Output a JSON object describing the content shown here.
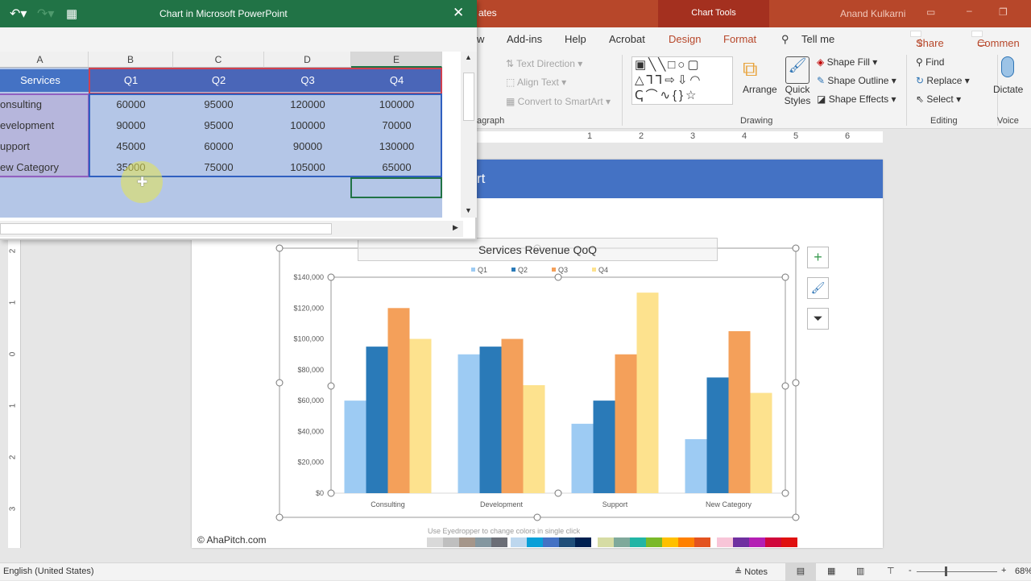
{
  "powerpoint": {
    "title_fragment": "ates",
    "context_tab": "Chart Tools",
    "user": "Anand Kulkarni",
    "tabs": [
      "w",
      "Add-ins",
      "Help",
      "Acrobat",
      "Design",
      "Format"
    ],
    "tell_me": "Tell me",
    "share": "Share",
    "comments": "Commen",
    "ribbon": {
      "paragraph": {
        "text_direction": "Text Direction",
        "align_text": "Align Text",
        "convert_smartart": "Convert to SmartArt",
        "label": "agraph"
      },
      "drawing": {
        "arrange": "Arrange",
        "quick_styles": "Quick Styles",
        "shape_fill": "Shape Fill",
        "shape_outline": "Shape Outline",
        "shape_effects": "Shape Effects",
        "label": "Drawing"
      },
      "editing": {
        "find": "Find",
        "replace": "Replace",
        "select": "Select",
        "label": "Editing"
      },
      "voice": {
        "dictate": "Dictate",
        "label": "Voice"
      }
    },
    "ruler_numbers": [
      "1",
      "2",
      "3",
      "4",
      "5",
      "6"
    ],
    "vruler_numbers": [
      "2",
      "1",
      "0",
      "1",
      "2",
      "3"
    ],
    "status": {
      "language": "English (United States)",
      "notes": "Notes",
      "zoom": "68%"
    }
  },
  "slide": {
    "title_fragment": "rt",
    "footer": "© AhaPitch.com",
    "eyedropper_hint": "Use Eyedropper to change colors in single click",
    "palette": [
      "#d9d9d9",
      "#bfbfbf",
      "#a5968a",
      "#8497a0",
      "#6b6e76",
      "#bdd7ee",
      "#0aa0d8",
      "#4472c4",
      "#1f4e79",
      "#002050",
      "#d6dca4",
      "#7fa99b",
      "#22b5a5",
      "#7ab929",
      "#ffc000",
      "#ff8000",
      "#e35320",
      "#f8c5d8",
      "#7030a0",
      "#b41fb4",
      "#d0073b",
      "#e01010"
    ]
  },
  "excel": {
    "title": "Chart in Microsoft PowerPoint",
    "columns": [
      "A",
      "B",
      "C",
      "D",
      "E"
    ],
    "header": [
      "Services",
      "Q1",
      "Q2",
      "Q3",
      "Q4"
    ],
    "rows": [
      [
        "onsulting",
        "60000",
        "95000",
        "120000",
        "100000"
      ],
      [
        "evelopment",
        "90000",
        "95000",
        "100000",
        "70000"
      ],
      [
        "upport",
        "45000",
        "60000",
        "90000",
        "130000"
      ],
      [
        "ew Category",
        "35000",
        "75000",
        "105000",
        "65000"
      ]
    ]
  },
  "chart_data": {
    "type": "bar",
    "title": "Services Revenue QoQ",
    "categories": [
      "Consulting",
      "Development",
      "Support",
      "New Category"
    ],
    "series": [
      {
        "name": "Q1",
        "color": "#9dcbf3",
        "values": [
          60000,
          90000,
          45000,
          35000
        ]
      },
      {
        "name": "Q2",
        "color": "#2a7ab8",
        "values": [
          95000,
          95000,
          60000,
          75000
        ]
      },
      {
        "name": "Q3",
        "color": "#f4a05a",
        "values": [
          120000,
          100000,
          90000,
          105000
        ]
      },
      {
        "name": "Q4",
        "color": "#fde28e",
        "values": [
          100000,
          70000,
          130000,
          65000
        ]
      }
    ],
    "ylim": [
      0,
      140000
    ],
    "yticks": [
      "$0",
      "$20,000",
      "$40,000",
      "$60,000",
      "$80,000",
      "$100,000",
      "$120,000",
      "$140,000"
    ],
    "legend": "top",
    "grid": false
  }
}
